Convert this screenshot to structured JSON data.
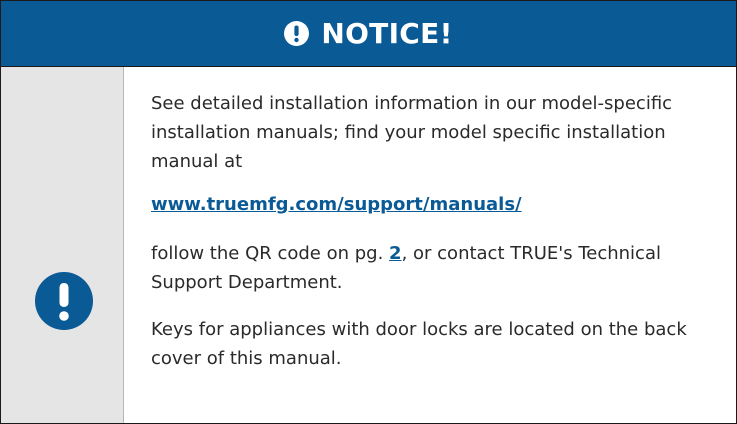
{
  "header": {
    "title": "NOTICE!",
    "icon": "exclamation-circle-icon"
  },
  "side": {
    "icon": "exclamation-circle-icon"
  },
  "content": {
    "paragraph_1": "See detailed installation information in our model-specific installation manuals; find your model specific installation manual at",
    "link_text": "www.truemfg.com/support/manuals/",
    "paragraph_2_before": "follow the QR code on pg. ",
    "paragraph_2_page": "2",
    "paragraph_2_after": ", or contact TRUE's Technical Support Department.",
    "paragraph_3": "Keys for appliances with door locks are located on the back cover of this manual."
  },
  "colors": {
    "brand_blue": "#0a5a96",
    "side_gray": "#e5e5e5",
    "text": "#2a2a2a"
  }
}
